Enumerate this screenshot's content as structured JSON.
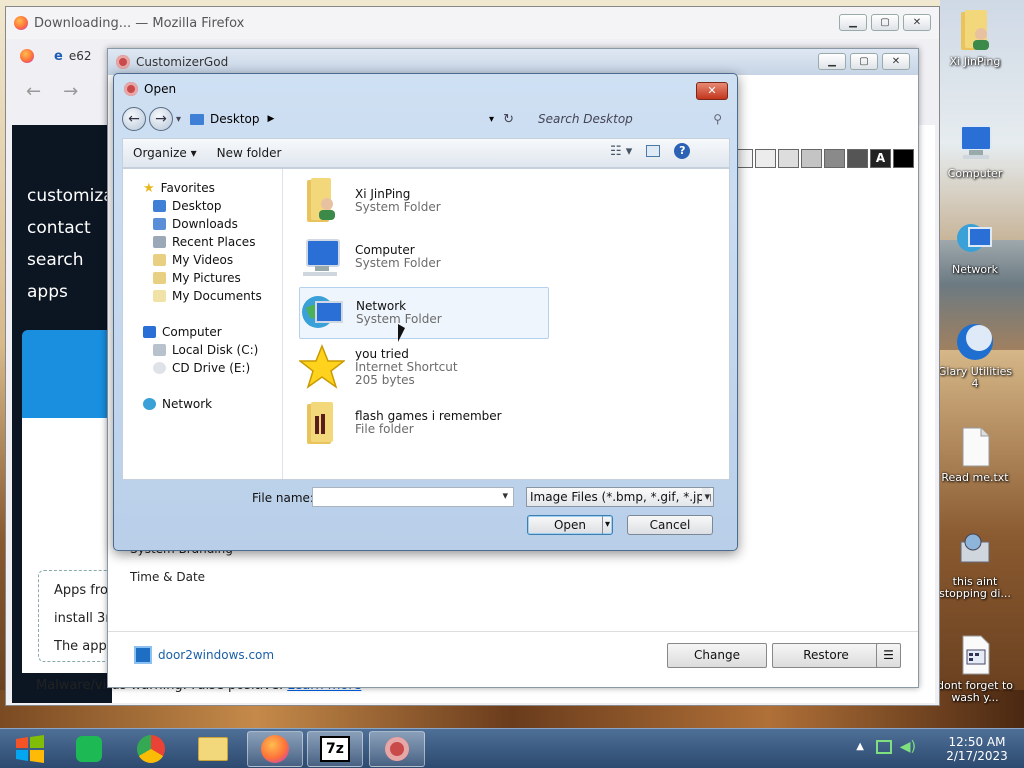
{
  "firefox": {
    "title": "Downloading... — Mozilla Firefox",
    "tab_label": "e62",
    "site_nav": [
      "customiza",
      "contact",
      "search",
      "apps"
    ],
    "warn_lines": [
      "Apps fro",
      "install 3r",
      "The app"
    ],
    "status_text": "Malware/virus warning: False positive.",
    "status_link": "Learn more"
  },
  "customizer": {
    "title": "CustomizerGod",
    "list_items": [
      "System Branding",
      "Time & Date"
    ],
    "brand": "door2windows.com",
    "buttons": {
      "change": "Change",
      "restore": "Restore",
      "menu": "☰"
    },
    "swatches": [
      "#f4f4f4",
      "#ececec",
      "#dddddd",
      "#c4c4c4",
      "#8a8a8a",
      "#555555",
      "#222222",
      "#000000"
    ],
    "swatch_letter": "A"
  },
  "dialog": {
    "title": "Open",
    "close_label": "✕",
    "location": "Desktop",
    "search_placeholder": "Search Desktop",
    "toolbar": {
      "organize": "Organize ▾",
      "new_folder": "New folder"
    },
    "nav": {
      "favorites_header": "Favorites",
      "favorites": [
        "Desktop",
        "Downloads",
        "Recent Places",
        "My Videos",
        "My Pictures",
        "My Documents"
      ],
      "computer_header": "Computer",
      "drives": [
        "Local Disk (C:)",
        "CD Drive (E:)"
      ],
      "network": "Network"
    },
    "files": [
      {
        "name": "Xi JinPing",
        "type": "System Folder",
        "extra": ""
      },
      {
        "name": "Computer",
        "type": "System Folder",
        "extra": ""
      },
      {
        "name": "Network",
        "type": "System Folder",
        "extra": ""
      },
      {
        "name": "you tried",
        "type": "Internet Shortcut",
        "extra": "205 bytes"
      },
      {
        "name": "flash games i remember",
        "type": "File folder",
        "extra": ""
      }
    ],
    "filename_label": "File name:",
    "filename_value": "",
    "filetype": "Image Files (*.bmp, *.gif, *.jpg",
    "open_label": "Open",
    "cancel_label": "Cancel"
  },
  "desktop_icons": [
    {
      "label": "Xi JinPing",
      "icon": "user-folder-icon"
    },
    {
      "label": "Computer",
      "icon": "computer-icon"
    },
    {
      "label": "Network",
      "icon": "network-icon"
    },
    {
      "label": "Glary Utilities 4",
      "icon": "glary-icon"
    },
    {
      "label": "Read me.txt",
      "icon": "text-file-icon"
    },
    {
      "label": "this aint stopping di...",
      "icon": "installer-icon"
    },
    {
      "label": "dont forget to wash y...",
      "icon": "calendar-file-icon"
    }
  ],
  "taskbar": {
    "time": "12:50 AM",
    "date": "2/17/2023",
    "apps": [
      "start",
      "notes",
      "chrome",
      "explorer",
      "firefox",
      "7zip",
      "customizergod"
    ]
  }
}
